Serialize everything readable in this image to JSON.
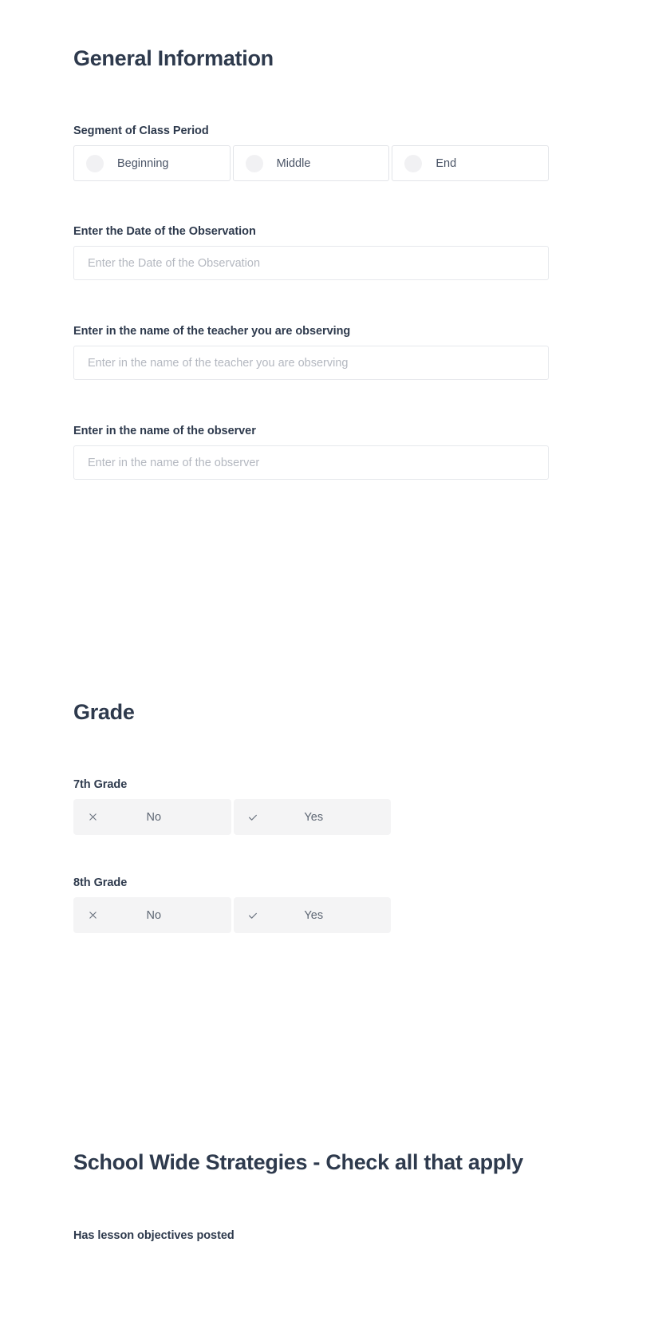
{
  "general": {
    "heading": "General Information",
    "segment": {
      "label": "Segment of Class Period",
      "options": [
        {
          "label": "Beginning",
          "icon": "radio-unchecked-icon"
        },
        {
          "label": "Middle",
          "icon": "radio-unchecked-icon"
        },
        {
          "label": "End",
          "icon": "radio-unchecked-icon"
        }
      ]
    },
    "date": {
      "label": "Enter the Date of the Observation",
      "placeholder": "Enter the Date of the Observation",
      "value": ""
    },
    "teacher": {
      "label": "Enter in the name of the teacher you are observing",
      "placeholder": "Enter in the name of the teacher you are observing",
      "value": ""
    },
    "observer": {
      "label": "Enter in the name of the observer",
      "placeholder": "Enter in the name of the observer",
      "value": ""
    }
  },
  "grade": {
    "heading": "Grade",
    "items": [
      {
        "label": "7th Grade",
        "no_label": "No",
        "yes_label": "Yes",
        "no_icon": "close-icon",
        "yes_icon": "check-icon"
      },
      {
        "label": "8th Grade",
        "no_label": "No",
        "yes_label": "Yes",
        "no_icon": "close-icon",
        "yes_icon": "check-icon"
      }
    ]
  },
  "strategies": {
    "heading": "School Wide Strategies - Check all that apply",
    "first_item_label": "Has lesson objectives posted"
  },
  "colors": {
    "heading_text": "#2e3a4d",
    "body_text": "#4a5466",
    "placeholder": "#b4b8c0",
    "input_border": "#e6e8ec",
    "toggle_bg": "#f4f4f5",
    "radio_fill": "#f1f1f3",
    "page_bg": "#ffffff"
  }
}
